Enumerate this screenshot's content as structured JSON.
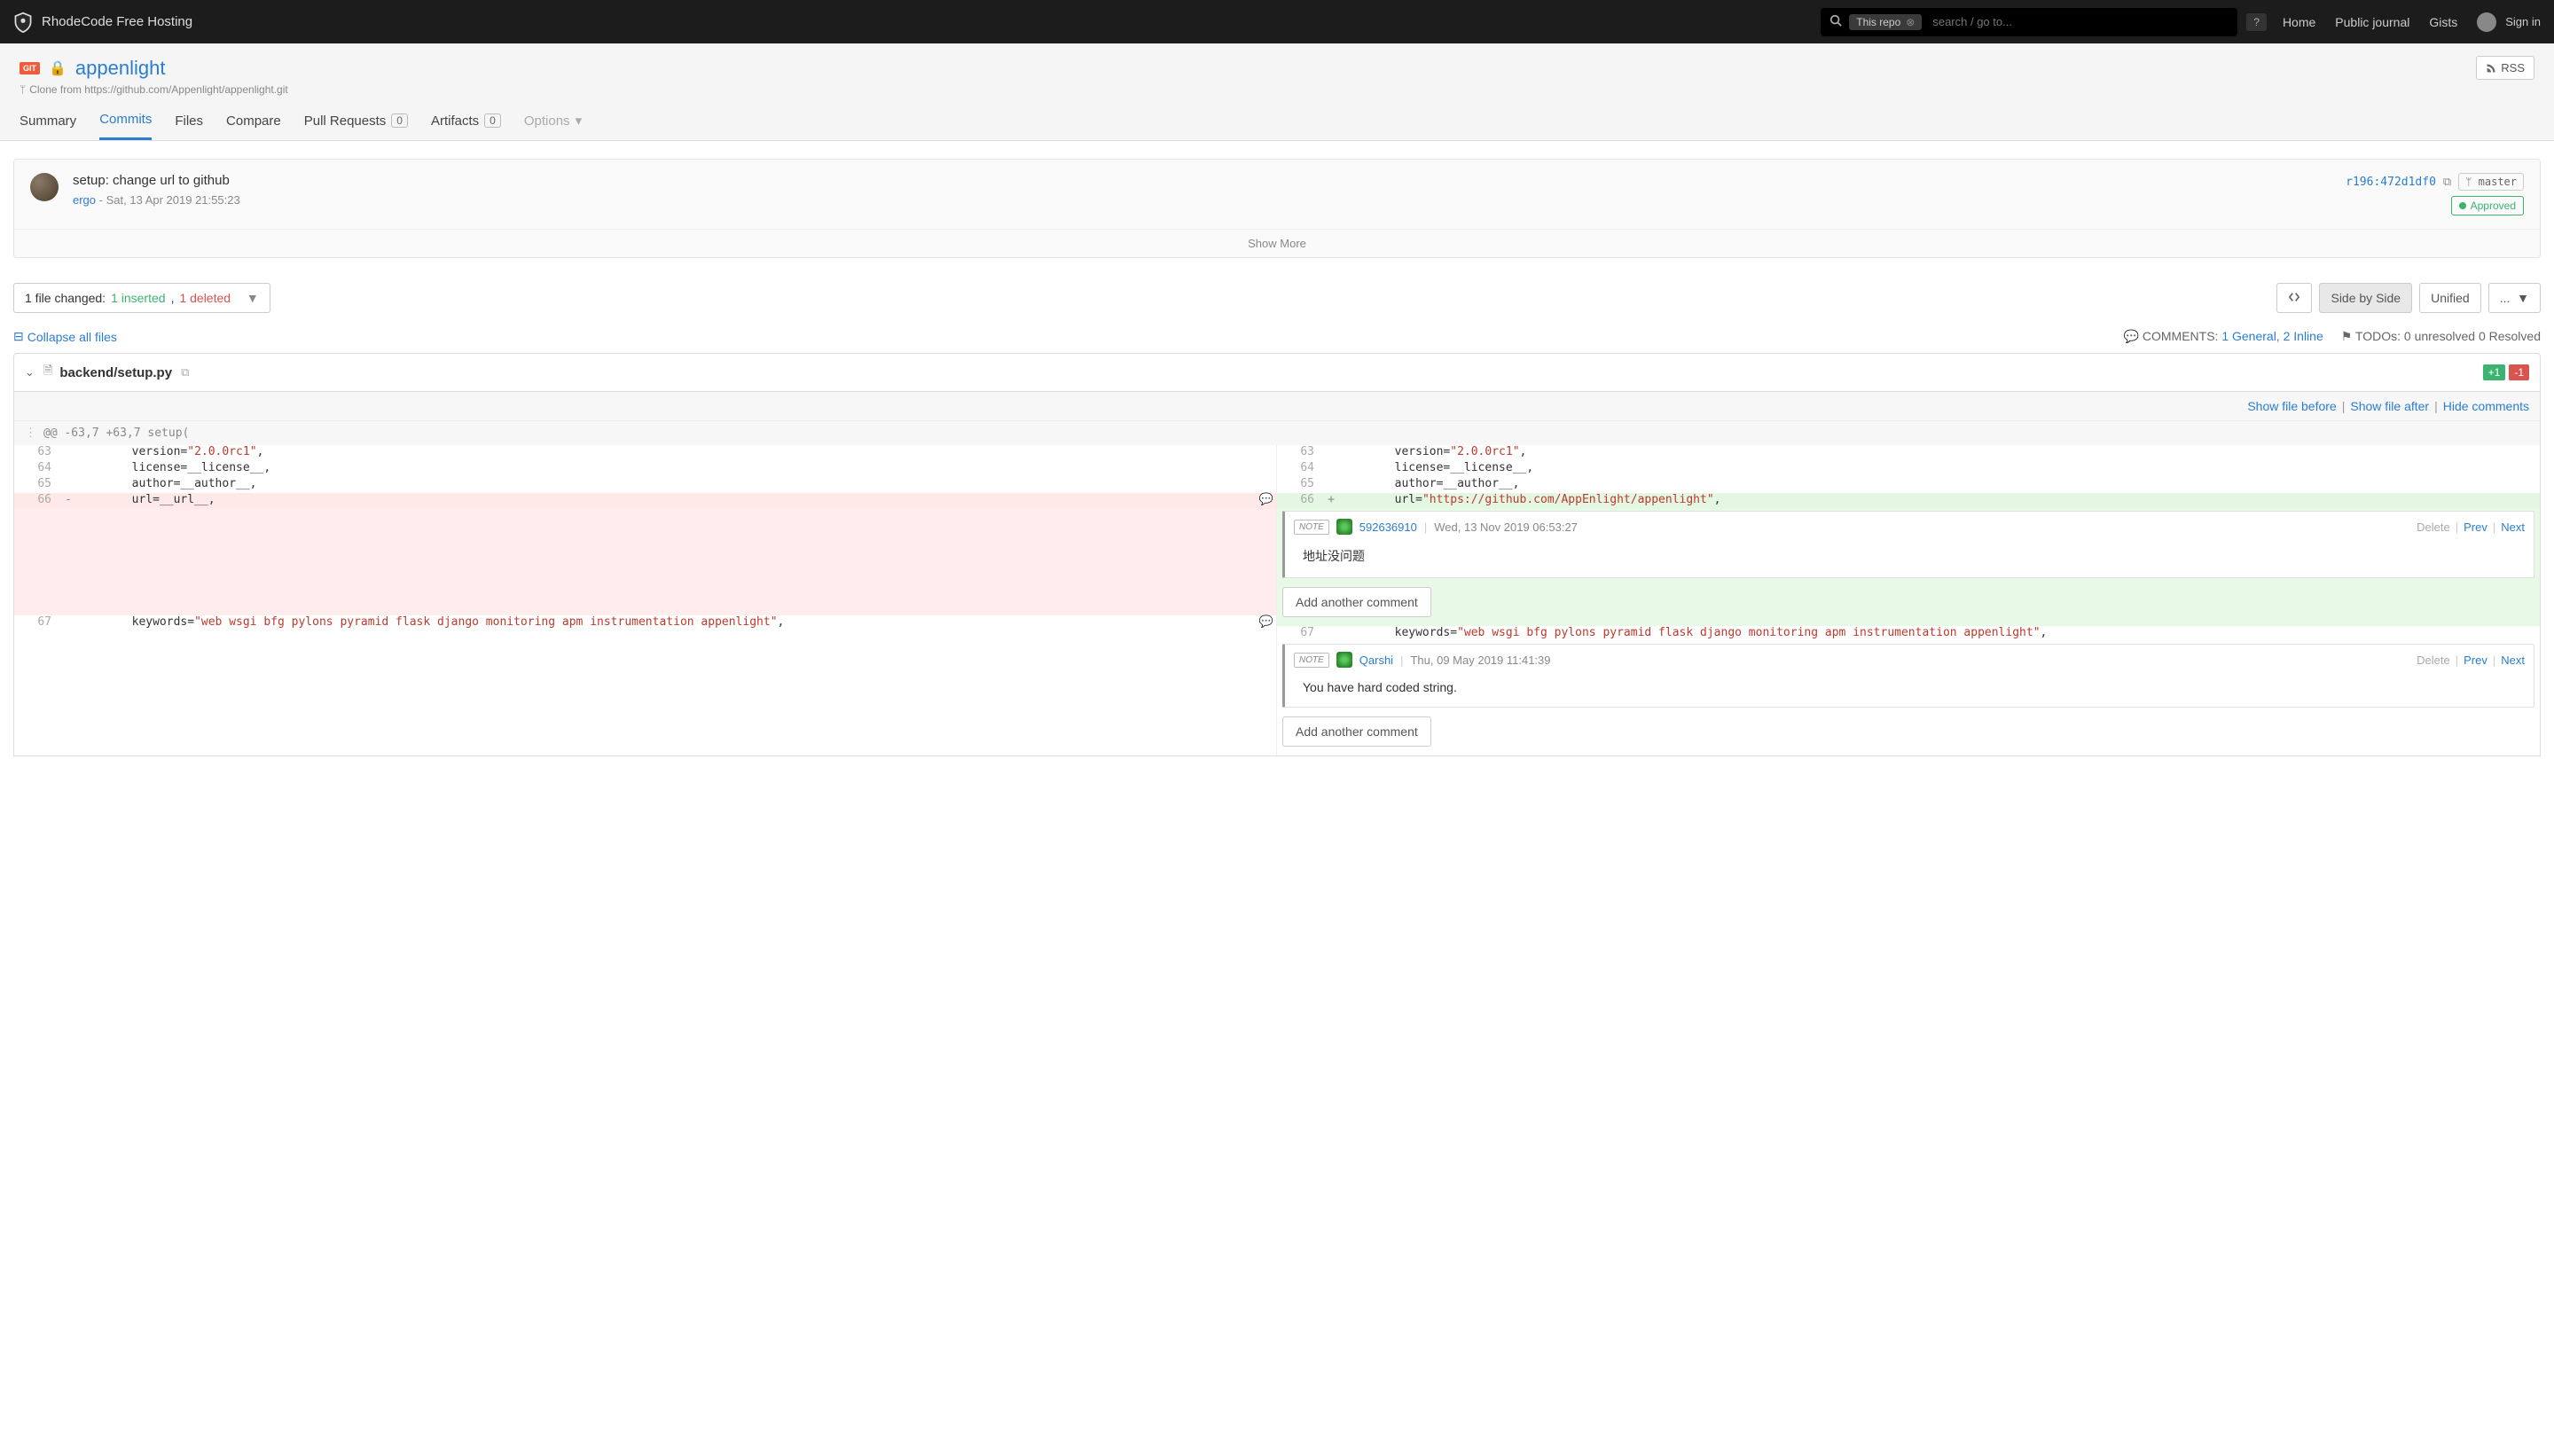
{
  "header": {
    "site_name": "RhodeCode Free Hosting",
    "search_scope": "This repo",
    "search_placeholder": "search / go to...",
    "help": "?",
    "nav": {
      "home": "Home",
      "journal": "Public journal",
      "gists": "Gists",
      "signin": "Sign in"
    }
  },
  "repo": {
    "badge": "GIT",
    "name": "appenlight",
    "subtext": "Clone from https://github.com/Appenlight/appenlight.git",
    "rss": "RSS",
    "tabs": {
      "summary": "Summary",
      "commits": "Commits",
      "files": "Files",
      "compare": "Compare",
      "pull_requests": "Pull Requests",
      "pr_count": "0",
      "artifacts": "Artifacts",
      "artifacts_count": "0",
      "options": "Options"
    }
  },
  "commit": {
    "title": "setup: change url to github",
    "author": "ergo",
    "sep": " - ",
    "date": "Sat, 13 Apr 2019 21:55:23",
    "hash": "r196:472d1df0",
    "branch_prefix": "ᛘ ",
    "branch": "master",
    "approved": "Approved",
    "show_more": "Show More"
  },
  "stats": {
    "prefix": "1 file changed: ",
    "inserted": "1 inserted",
    "comma": ", ",
    "deleted": "1 deleted"
  },
  "view": {
    "side_by_side": "Side by Side",
    "unified": "Unified",
    "more": "..."
  },
  "links": {
    "collapse": "Collapse all files",
    "comments_label": "COMMENTS: ",
    "comments_value": "1 General, 2 Inline",
    "todos_label": "TODOs: ",
    "todos_value": "0 unresolved 0 Resolved"
  },
  "file": {
    "name": "backend/setup.py",
    "plus": "+1",
    "minus": "-1",
    "show_before": "Show file before",
    "show_after": "Show file after",
    "hide_comments": "Hide comments",
    "hunk": "@@ -63,7 +63,7 setup("
  },
  "diff": {
    "left": [
      {
        "ln": "63",
        "pre": "        version=",
        "str": "\"2.0.0rc1\"",
        "post": ","
      },
      {
        "ln": "64",
        "pre": "        license=__license__,"
      },
      {
        "ln": "65",
        "pre": "        author=__author__,"
      },
      {
        "ln": "66",
        "sign": "-",
        "pre": "        url=__url__,",
        "del": true
      },
      {
        "ln": "67",
        "pre": "        keywords=",
        "str": "\"web wsgi bfg pylons pyramid flask django monitoring apm instrumentation appenlight\"",
        "post": ","
      }
    ],
    "right": [
      {
        "ln": "63",
        "pre": "        version=",
        "str": "\"2.0.0rc1\"",
        "post": ","
      },
      {
        "ln": "64",
        "pre": "        license=__license__,"
      },
      {
        "ln": "65",
        "pre": "        author=__author__,"
      },
      {
        "ln": "66",
        "sign": "+",
        "pre": "        url=",
        "str": "\"https://github.com/AppEnlight/appenlight\"",
        "post": ",",
        "add": true
      },
      {
        "ln": "67",
        "pre": "        keywords=",
        "str": "\"web wsgi bfg pylons pyramid flask django monitoring apm instrumentation appenlight\"",
        "post": ","
      }
    ]
  },
  "comments": {
    "note_tag": "NOTE",
    "delete": "Delete",
    "prev": "Prev",
    "next": "Next",
    "add_another": "Add another comment",
    "c1": {
      "author": "592636910",
      "date": "Wed, 13 Nov 2019 06:53:27",
      "body": "地址没问题"
    },
    "c2": {
      "author": "Qarshi",
      "date": "Thu, 09 May 2019 11:41:39",
      "body": "You have hard coded string."
    }
  }
}
